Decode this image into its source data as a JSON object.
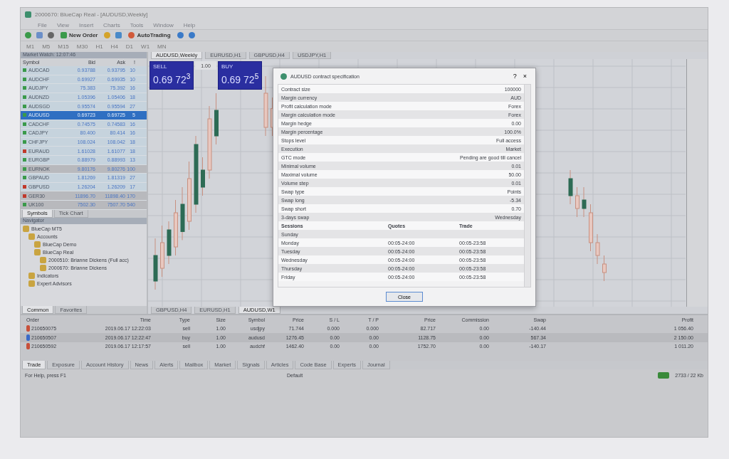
{
  "window": {
    "title": "2000670: BlueCap Real - [AUDUSD,Weekly]"
  },
  "menu": [
    "File",
    "View",
    "Insert",
    "Charts",
    "Tools",
    "Window",
    "Help"
  ],
  "toolbar": {
    "new_order": "New Order",
    "autotrading": "AutoTrading",
    "timeframes": [
      "M1",
      "M5",
      "M15",
      "M30",
      "H1",
      "H4",
      "D1",
      "W1",
      "MN"
    ]
  },
  "market_watch": {
    "title": "Market Watch: 12:07:46",
    "columns": [
      "Symbol",
      "Bid",
      "Ask",
      "!"
    ],
    "rows": [
      {
        "symbol": "AUDCAD",
        "bid": "0.93788",
        "ask": "0.93795",
        "spread": "10",
        "color": "#3a9a4a",
        "selected": false,
        "highlighted": false
      },
      {
        "symbol": "AUDCHF",
        "bid": "0.69927",
        "ask": "0.69935",
        "spread": "10",
        "color": "#3a9a4a",
        "selected": false,
        "highlighted": false
      },
      {
        "symbol": "AUDJPY",
        "bid": "75.383",
        "ask": "75.392",
        "spread": "16",
        "color": "#3a9a4a",
        "selected": false,
        "highlighted": false
      },
      {
        "symbol": "AUDNZD",
        "bid": "1.05396",
        "ask": "1.05406",
        "spread": "18",
        "color": "#3a9a4a",
        "selected": false,
        "highlighted": false
      },
      {
        "symbol": "AUDSGD",
        "bid": "0.95574",
        "ask": "0.95594",
        "spread": "27",
        "color": "#3a9a4a",
        "selected": false,
        "highlighted": false
      },
      {
        "symbol": "AUDUSD",
        "bid": "0.69723",
        "ask": "0.69725",
        "spread": "5",
        "color": "#3a9a4a",
        "selected": true,
        "highlighted": false
      },
      {
        "symbol": "CADCHF",
        "bid": "0.74575",
        "ask": "0.74583",
        "spread": "16",
        "color": "#3a9a4a",
        "selected": false,
        "highlighted": false
      },
      {
        "symbol": "CADJPY",
        "bid": "80.400",
        "ask": "80.414",
        "spread": "16",
        "color": "#3a9a4a",
        "selected": false,
        "highlighted": false
      },
      {
        "symbol": "CHFJPY",
        "bid": "108.024",
        "ask": "108.042",
        "spread": "18",
        "color": "#3a9a4a",
        "selected": false,
        "highlighted": false
      },
      {
        "symbol": "EURAUD",
        "bid": "1.61028",
        "ask": "1.61077",
        "spread": "18",
        "color": "#c0392b",
        "selected": false,
        "highlighted": false
      },
      {
        "symbol": "EURGBP",
        "bid": "0.88979",
        "ask": "0.88993",
        "spread": "13",
        "color": "#3a9a4a",
        "selected": false,
        "highlighted": false
      },
      {
        "symbol": "EURNOK",
        "bid": "9.80176",
        "ask": "9.80276",
        "spread": "100",
        "color": "#3a9a4a",
        "selected": false,
        "highlighted": true
      },
      {
        "symbol": "GBPAUD",
        "bid": "1.81269",
        "ask": "1.81319",
        "spread": "27",
        "color": "#3a9a4a",
        "selected": false,
        "highlighted": false
      },
      {
        "symbol": "GBPUSD",
        "bid": "1.26204",
        "ask": "1.26209",
        "spread": "17",
        "color": "#c0392b",
        "selected": false,
        "highlighted": false
      },
      {
        "symbol": "GER30",
        "bid": "11896.70",
        "ask": "11898.40",
        "spread": "170",
        "color": "#c0392b",
        "selected": false,
        "highlighted": true
      },
      {
        "symbol": "UK100",
        "bid": "7502.30",
        "ask": "7507.70",
        "spread": "540",
        "color": "#3a9a4a",
        "selected": false,
        "highlighted": true
      }
    ],
    "tabs": [
      {
        "label": "Symbols",
        "selected": true
      },
      {
        "label": "Tick Chart",
        "selected": false
      }
    ]
  },
  "navigator": {
    "title": "Navigator",
    "tree": [
      {
        "label": "BlueCap MT5",
        "children": [
          {
            "label": "Accounts",
            "children": [
              {
                "label": "BlueCap Demo"
              },
              {
                "label": "BlueCap Real",
                "children": [
                  {
                    "label": "2000510: Brianne Dickens (Full acc)"
                  },
                  {
                    "label": "2000670: Brianne Dickens"
                  }
                ]
              }
            ]
          },
          {
            "label": "Indicators"
          },
          {
            "label": "Expert Advisors"
          }
        ]
      }
    ],
    "tabs": [
      {
        "label": "Common",
        "selected": true
      },
      {
        "label": "Favorites",
        "selected": false
      }
    ]
  },
  "chart": {
    "tabs": [
      {
        "label": "AUDUSD,Weekly",
        "selected": true
      },
      {
        "label": "EURUSD,H1",
        "selected": false
      },
      {
        "label": "GBPUSD,H4",
        "selected": false
      },
      {
        "label": "USDJPY,H1",
        "selected": false
      }
    ],
    "one_click": {
      "sell": "SELL",
      "buy": "BUY",
      "volume": "1.00",
      "sell_prefix": "0.69",
      "sell_big": "72",
      "sell_sup": "3",
      "buy_prefix": "0.69",
      "buy_big": "72",
      "buy_sup": "5"
    },
    "bottom_tabs": [
      {
        "label": "GBPUSD,H4",
        "selected": false
      },
      {
        "label": "EURUSD,H1",
        "selected": false
      },
      {
        "label": "AUDUSD,W1",
        "selected": true
      }
    ]
  },
  "dialog": {
    "title": "AUDUSD contract specification",
    "help": "?",
    "close": "×",
    "rows": [
      {
        "label": "Contract size",
        "value": "100000"
      },
      {
        "label": "Margin currency",
        "value": "AUD"
      },
      {
        "label": "Profit calculation mode",
        "value": "Forex"
      },
      {
        "label": "Margin calculation mode",
        "value": "Forex"
      },
      {
        "label": "Margin hedge",
        "value": "0.00"
      },
      {
        "label": "Margin percentage",
        "value": "100.0%"
      },
      {
        "label": "Stops level",
        "value": "Full access"
      },
      {
        "label": "Execution",
        "value": "Market"
      },
      {
        "label": "GTC mode",
        "value": "Pending are good till cancel"
      },
      {
        "label": "Minimal volume",
        "value": "0.01"
      },
      {
        "label": "Maximal volume",
        "value": "50.00"
      },
      {
        "label": "Volume step",
        "value": "0.01"
      },
      {
        "label": "Swap type",
        "value": "Points"
      },
      {
        "label": "Swap long",
        "value": "-5.34"
      },
      {
        "label": "Swap short",
        "value": "0.70"
      },
      {
        "label": "3-days swap",
        "value": "Wednesday"
      }
    ],
    "sessions": {
      "columns": [
        "Sessions",
        "Quotes",
        "Trade"
      ],
      "rows": [
        [
          "Sunday",
          "",
          ""
        ],
        [
          "Monday",
          "00:05-24:00",
          "00:05-23:58"
        ],
        [
          "Tuesday",
          "00:05-24:00",
          "00:05-23:58"
        ],
        [
          "Wednesday",
          "00:05-24:00",
          "00:05-23:58"
        ],
        [
          "Thursday",
          "00:05-24:00",
          "00:05-23:58"
        ],
        [
          "Friday",
          "00:05-24:00",
          "00:05-23:58"
        ]
      ]
    },
    "button": "Close"
  },
  "terminal": {
    "columns": [
      "Order",
      "Time",
      "Type",
      "Size",
      "Symbol",
      "Price",
      "S / L",
      "T / P",
      "Price",
      "Commission",
      "Swap",
      "Profit"
    ],
    "rows": [
      {
        "kind": "sell",
        "cells": [
          "210650075",
          "2019.06.17 12:22:03",
          "sell",
          "1.00",
          "usdjpy",
          "71.744",
          "0.000",
          "0.000",
          "82.717",
          "0.00",
          "-140.44",
          "1 056.40"
        ]
      },
      {
        "kind": "buy",
        "cells": [
          "210650507",
          "2019.06.17 12:22:47",
          "buy",
          "1.00",
          "audusd",
          "1276.45",
          "0.00",
          "0.00",
          "1128.75",
          "0.00",
          "567.34",
          "2 150.00"
        ]
      },
      {
        "kind": "sell",
        "cells": [
          "210650592",
          "2019.06.17 12:17:57",
          "sell",
          "1.00",
          "audchf",
          "1462.40",
          "0.00",
          "0.00",
          "1752.70",
          "0.00",
          "-140.17",
          "1 011.20"
        ]
      }
    ],
    "tabs": [
      {
        "label": "Trade",
        "selected": true
      },
      {
        "label": "Exposure",
        "selected": false
      },
      {
        "label": "Account History",
        "selected": false
      },
      {
        "label": "News",
        "selected": false
      },
      {
        "label": "Alerts",
        "selected": false
      },
      {
        "label": "Mailbox",
        "selected": false
      },
      {
        "label": "Market",
        "selected": false
      },
      {
        "label": "Signals",
        "selected": false
      },
      {
        "label": "Articles",
        "selected": false
      },
      {
        "label": "Code Base",
        "selected": false
      },
      {
        "label": "Experts",
        "selected": false
      },
      {
        "label": "Journal",
        "selected": false
      }
    ]
  },
  "status_bar": {
    "help": "For Help, press F1",
    "profile": "Default",
    "traffic": "2733 / 22 Kb"
  }
}
